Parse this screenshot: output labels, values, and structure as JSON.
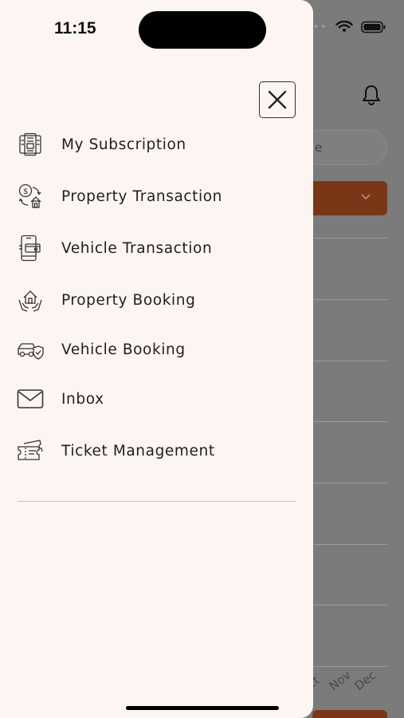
{
  "status_bar": {
    "time": "11:15"
  },
  "drawer": {
    "close_icon": "close-icon",
    "menu_items": [
      {
        "label": "My Subscription",
        "icon": "subscription-icon"
      },
      {
        "label": "Property Transaction",
        "icon": "property-transaction-icon"
      },
      {
        "label": "Vehicle Transaction",
        "icon": "vehicle-transaction-icon"
      },
      {
        "label": "Property Booking",
        "icon": "property-booking-icon"
      },
      {
        "label": "Vehicle Booking",
        "icon": "vehicle-booking-icon"
      },
      {
        "label": "Inbox",
        "icon": "mail-icon"
      },
      {
        "label": "Ticket Management",
        "icon": "ticket-icon"
      }
    ]
  },
  "background_app": {
    "search_text": "e",
    "month_labels": [
      "ct",
      "Nov",
      "Dec"
    ]
  },
  "colors": {
    "drawer_background": "#fcf5f2",
    "accent": "#7a3717",
    "overlay": "#7b7b7b",
    "text": "#1f1f1f"
  }
}
